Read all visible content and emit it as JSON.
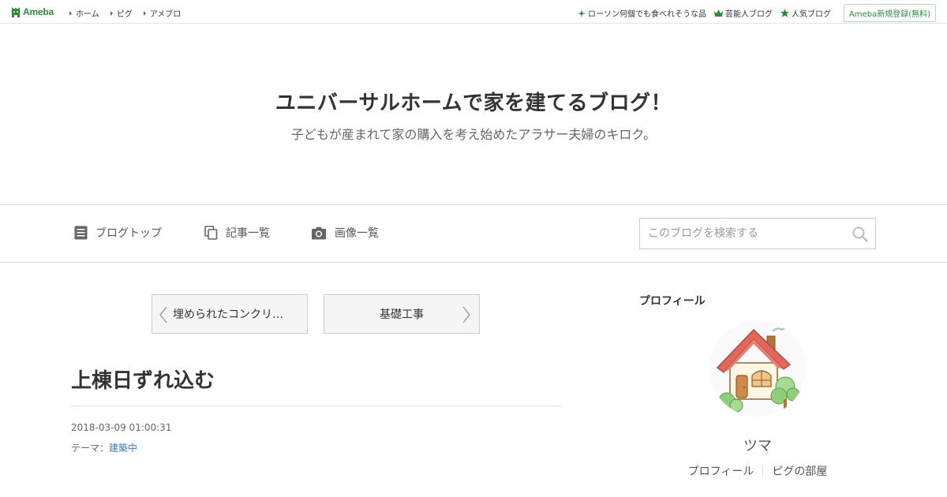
{
  "global_header": {
    "logo_text": "Ameba",
    "nav": [
      {
        "label": "ホーム"
      },
      {
        "label": "ピグ"
      },
      {
        "label": "アメブロ"
      }
    ],
    "links": [
      {
        "label": "ローソン何個でも食べれそうな品",
        "icon": "sparkle-icon"
      },
      {
        "label": "芸能人ブログ",
        "icon": "crown-icon"
      },
      {
        "label": "人気ブログ",
        "icon": "star-icon"
      }
    ],
    "register_label": "Ameba新規登録(無料)",
    "accent_color": "#2d8c3c"
  },
  "blog": {
    "title": "ユニバーサルホームで家を建てるブログ！",
    "description": "子どもが産まれて家の購入を考え始めたアラサー夫婦のキロク。"
  },
  "blog_nav": {
    "items": [
      {
        "label": "ブログトップ",
        "icon": "document-icon"
      },
      {
        "label": "記事一覧",
        "icon": "copy-icon"
      },
      {
        "label": "画像一覧",
        "icon": "camera-icon"
      }
    ],
    "search_placeholder": "このブログを検索する"
  },
  "pagination": {
    "prev_label": "埋められたコンクリ…",
    "next_label": "基礎工事"
  },
  "article": {
    "title": "上棟日ずれ込む",
    "datetime": "2018-03-09 01:00:31",
    "theme_prefix": "テーマ：",
    "theme": "建築中",
    "theme_link_color": "#3a7bbf"
  },
  "sidebar": {
    "heading": "プロフィール",
    "nickname": "ツマ",
    "links": [
      {
        "label": "プロフィール"
      },
      {
        "label": "ピグの部屋"
      }
    ]
  }
}
